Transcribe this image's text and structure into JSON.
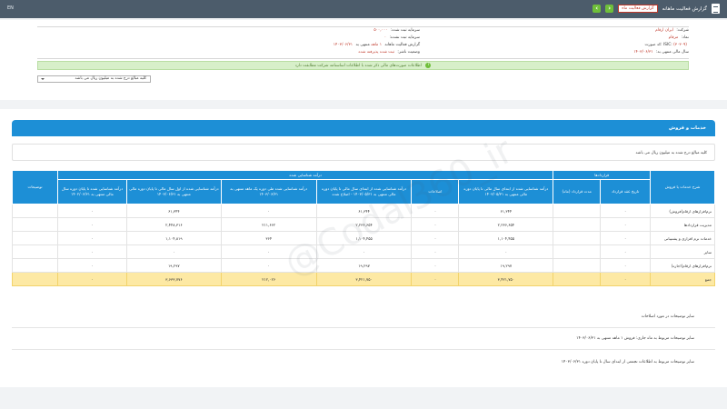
{
  "topbar": {
    "left_text": "EN",
    "title": "گزارش فعالیت ماهانه",
    "badge": "گزارش فعالیت ماه"
  },
  "header": {
    "company_label": "شرکت:",
    "company_value": "ایران ارقام",
    "symbol_label": "نماد:",
    "symbol_value": "مرقام",
    "code_label": "کد صورت:",
    "code_value": "(۳۰۳۰۹)",
    "isic_label": "ISIC:",
    "fiscal_label": "سال مالی منتهی به:",
    "fiscal_value": "۱۴۰۳/۰۶/۳۱",
    "capital_reg_label": "سرمایه ثبت شده:",
    "capital_reg_value": "۵۰۰,۰۰۰",
    "capital_unreg_label": "سرمایه ثبت نشده:",
    "capital_unreg_value": "۰",
    "report_label": "گزارش فعالیت ماهانه",
    "report_period": "۱ ماهه",
    "period_end_label": "منتهی به",
    "period_end_value": "۱۴۰۳/۰۶/۳۱",
    "state_label": "وضعیت ناشر:",
    "state_value": "ثبت شده پذیرفته شده"
  },
  "status_message": "اطلاعات صورت‌های مالی ذکر شده با اطلاعات اساسنامه شرکت مطابقت دارد",
  "unit_select": {
    "value": "کلیه مبالغ درج شده به میلیون ریال می باشد"
  },
  "section": {
    "title": "خدمات و فروش",
    "note": "کلیه مبالغ درج شده به میلیون ریال می باشد"
  },
  "table": {
    "group_headers": {
      "desc": "شرح خدمات یا فروش",
      "contract": "قرارداد‌ها",
      "recognized": "درآمد شناسایی شده",
      "notes": "توضیحات"
    },
    "sub_headers": [
      "تاریخ عقد قرارداد",
      "مدت قرارداد (ماه)",
      "درآمد شناسایی شده از ابتدای سال مالی تا پایان دوره مالی منتهی به ۱۴۰۳/۰۵/۳۱",
      "اصلاحات",
      "درآمد شناسایی شده از ابتدای سال مالی تا پایان دوره مالی منتهی به ۱۴۰۳/۰۵/۳۱ - اصلاح شده",
      "درآمد شناسایی شده طی دوره یک ماهه منتهی به ۱۴۰۳/۰۶/۳۱",
      "درآمد شناسایی شده از اول سال مالی تا پایان دوره مالی منتهی به ۱۴۰۳/۰۶/۳۱",
      "درآمد شناسایی شده تا پایان دوره سال مالی منتهی به ۱۴۰۲/۰۶/۳۱"
    ],
    "rows": [
      {
        "label": "نرم‌افزارهای ارقام(فروش)",
        "c1": "۰",
        "c2": "",
        "c3": "۶۱,۳۴۴",
        "c4": "۰",
        "c5": "۶۱,۳۴۴",
        "c6": "۰",
        "c7": "۶۱,۳۴۴",
        "c8": "۰"
      },
      {
        "label": "مدیریت قراردادها",
        "c1": "۰",
        "c2": "",
        "c3": "۲,۲۳۶,۶۵۴",
        "c4": "۰",
        "c5": "۲,۲۳۶,۶۵۴",
        "c6": "۲۱۱,۶۶۲",
        "c7": "۲,۴۴۸,۳۱۶",
        "c8": "۰"
      },
      {
        "label": "خدمات نرم افزاری و پشتیبانی",
        "c1": "۰",
        "c2": "",
        "c3": "۱,۱۰۴,۴۵۵",
        "c4": "۰",
        "c5": "۱,۱۰۴,۴۵۵",
        "c6": "۳۶۴",
        "c7": "۱,۱۰۴,۸۱۹",
        "c8": "۰"
      },
      {
        "label": "سایر",
        "c1": "۰",
        "c2": "",
        "c3": "۰",
        "c4": "۰",
        "c5": "۰",
        "c6": "۰",
        "c7": "۰",
        "c8": "۰"
      },
      {
        "label": "نرم‌افزارهای ارقام(اجاره)",
        "c1": "۰",
        "c2": "",
        "c3": "۱۹,۲۹۷",
        "c4": "۰",
        "c5": "۱۹,۲۹۷",
        "c6": "۰",
        "c7": "۱۹,۲۹۷",
        "c8": "۰"
      }
    ],
    "total": {
      "label": "جمع",
      "c1": "۰",
      "c2": "",
      "c3": "۳,۴۲۱,۷۵۰",
      "c4": "۰",
      "c5": "۳,۴۲۱,۷۵۰",
      "c6": "۲۱۲,۰۲۶",
      "c7": "۳,۶۳۳,۷۷۶",
      "c8": "۰"
    }
  },
  "comments": {
    "c1": "سایر توضیحات در مورد اصلاحات",
    "c2": "سایر توضیحات مربوط به ماه جاری: فروش ۱ ماهه منتهی به ۱۴۰۳/۰۶/۳۱",
    "c3": "سایر توضیحات مربوط به اطلاعات تجمعی از ابتدای سال تا پایان دوره ۱۴۰۳/۰۶/۳۱"
  },
  "watermark": "@Codal360_ir"
}
